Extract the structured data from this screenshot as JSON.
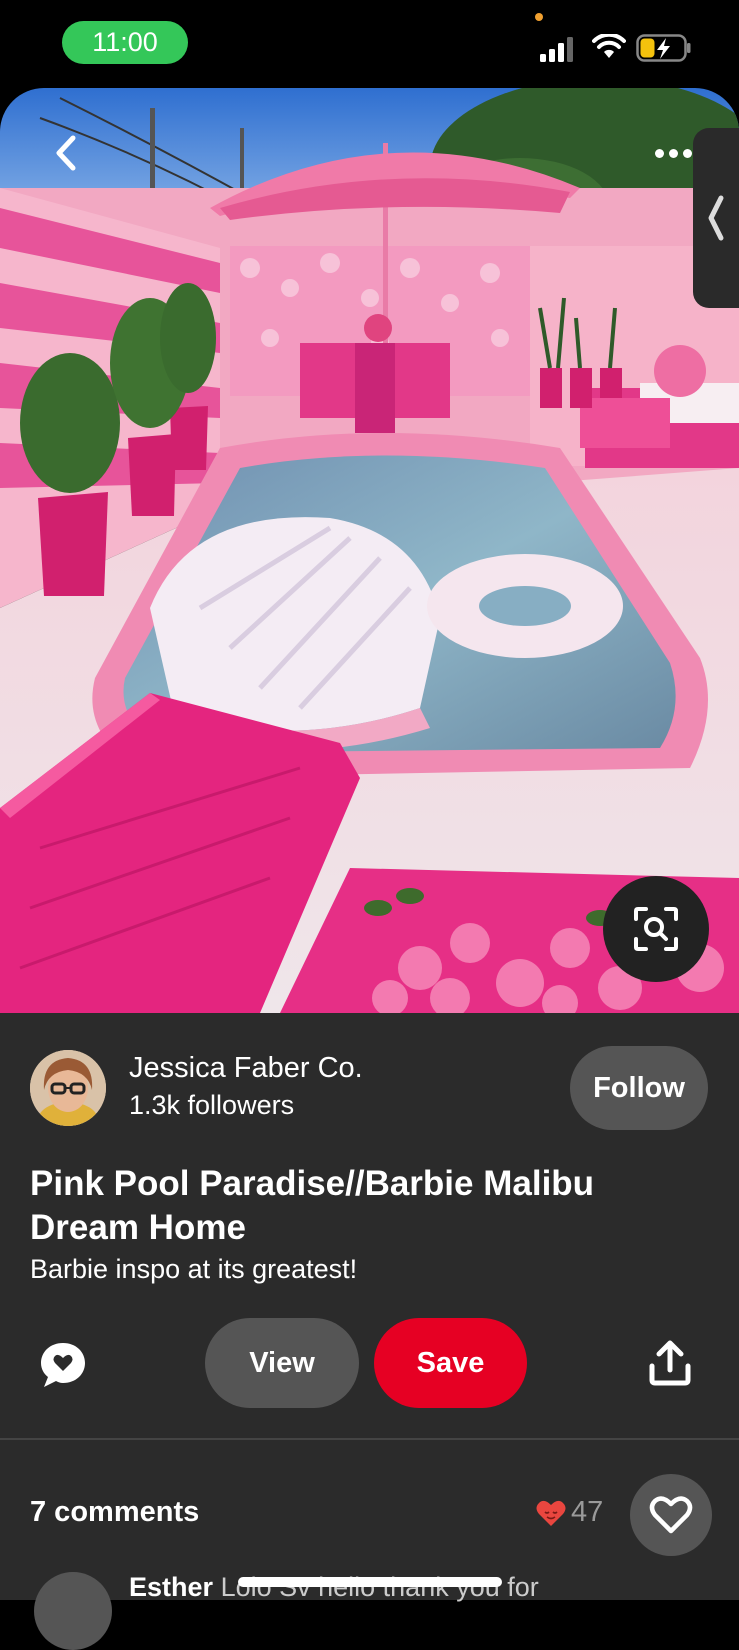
{
  "status_bar": {
    "time": "11:00",
    "icons": [
      "signal-icon",
      "wifi-icon",
      "battery-charging-icon"
    ],
    "time_pill_color": "#34c759"
  },
  "pin": {
    "image_description_icon": "pool-image",
    "nav": {
      "back_icon": "chevron-left-icon",
      "more_icon": "more-horizontal-icon",
      "side_tab_icon": "chevron-left-icon",
      "visual_search_icon": "lens-search-icon"
    },
    "creator": {
      "name": "Jessica Faber Co.",
      "followers": "1.3k followers",
      "follow_label": "Follow"
    },
    "title": "Pink Pool Paradise//Barbie Malibu Dream Home",
    "description": "Barbie inspo at its greatest!",
    "actions": {
      "comment_icon": "comment-bubble-icon",
      "view_label": "View",
      "save_label": "Save",
      "share_icon": "share-icon",
      "save_color": "#e60023"
    }
  },
  "comments": {
    "count_label": "7 comments",
    "reaction_icon": "heart-icon",
    "reaction_count": "47",
    "like_icon": "heart-outline-icon",
    "preview": {
      "author": "Esther",
      "text": "Lolo Sv hello thank you for"
    }
  }
}
